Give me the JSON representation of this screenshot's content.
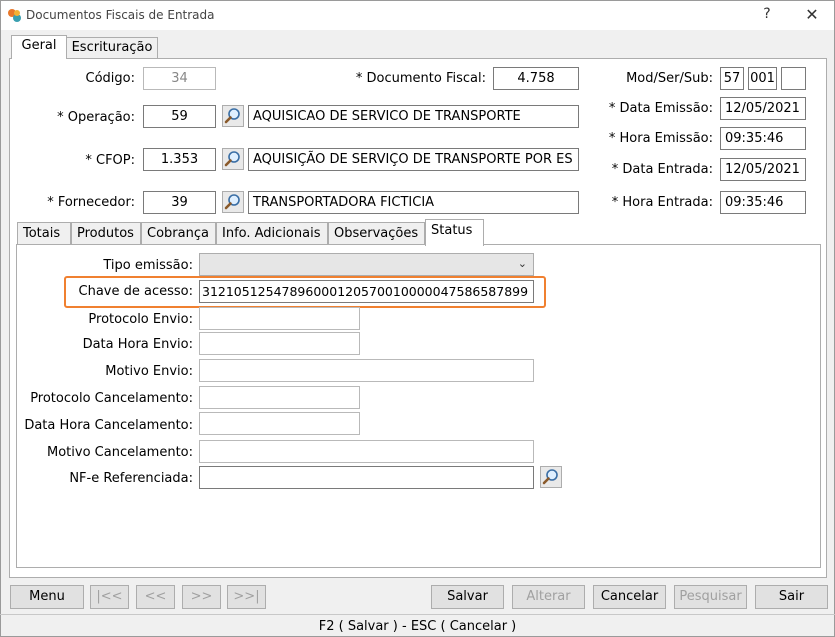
{
  "window": {
    "title": "Documentos Fiscais de Entrada",
    "help_label": "?",
    "close_label": "✕"
  },
  "main_tabs": [
    {
      "label": "Geral",
      "active": true
    },
    {
      "label": "Escrituração",
      "active": false
    }
  ],
  "form": {
    "codigo": {
      "label": "Código:",
      "value": "34"
    },
    "documento_fiscal": {
      "label": "* Documento Fiscal:",
      "value": "4.758"
    },
    "mod_ser_sub": {
      "label": "Mod/Ser/Sub:",
      "mod": "57",
      "ser": "001",
      "sub": ""
    },
    "operacao": {
      "label": "* Operação:",
      "code": "59",
      "description": "AQUISICAO DE SERVICO DE TRANSPORTE"
    },
    "cfop": {
      "label": "* CFOP:",
      "code": "1.353",
      "description": "AQUISIÇÃO DE SERVIÇO DE TRANSPORTE POR ES"
    },
    "fornecedor": {
      "label": "* Fornecedor:",
      "code": "39",
      "description": "TRANSPORTADORA FICTICIA"
    },
    "data_emissao": {
      "label": "* Data Emissão:",
      "value": "12/05/2021"
    },
    "hora_emissao": {
      "label": "* Hora Emissão:",
      "value": "09:35:46"
    },
    "data_entrada": {
      "label": "* Data Entrada:",
      "value": "12/05/2021"
    },
    "hora_entrada": {
      "label": "* Hora Entrada:",
      "value": "09:35:46"
    }
  },
  "sub_tabs": [
    {
      "label": "Totais",
      "active": false
    },
    {
      "label": "Produtos",
      "active": false
    },
    {
      "label": "Cobrança",
      "active": false
    },
    {
      "label": "Info. Adicionais",
      "active": false
    },
    {
      "label": "Observações",
      "active": false
    },
    {
      "label": "Status",
      "active": true
    }
  ],
  "status": {
    "tipo_emissao": {
      "label": "Tipo emissão:",
      "value": ""
    },
    "chave_acesso": {
      "label": "Chave de acesso:",
      "value": "31210512547896000120570010000047586587899"
    },
    "protocolo_envio": {
      "label": "Protocolo Envio:",
      "value": ""
    },
    "data_hora_envio": {
      "label": "Data Hora Envio:",
      "value": ""
    },
    "motivo_envio": {
      "label": "Motivo Envio:",
      "value": ""
    },
    "protocolo_cancelamento": {
      "label": "Protocolo Cancelamento:",
      "value": ""
    },
    "data_hora_cancelamento": {
      "label": "Data Hora Cancelamento:",
      "value": ""
    },
    "motivo_cancelamento": {
      "label": "Motivo Cancelamento:",
      "value": ""
    },
    "nfe_referenciada": {
      "label": "NF-e Referenciada:",
      "value": ""
    }
  },
  "toolbar": {
    "menu": "Menu",
    "first": "|<<",
    "prev": "<<",
    "next": ">>",
    "last": ">>|",
    "salvar": "Salvar",
    "alterar": "Alterar",
    "cancelar": "Cancelar",
    "pesquisar": "Pesquisar",
    "sair": "Sair"
  },
  "statusbar": {
    "text": "F2 ( Salvar )  -  ESC ( Cancelar )"
  },
  "colors": {
    "highlight": "#f08030",
    "app_icon_orange": "#e8782a",
    "app_icon_teal": "#3a9fb0"
  }
}
